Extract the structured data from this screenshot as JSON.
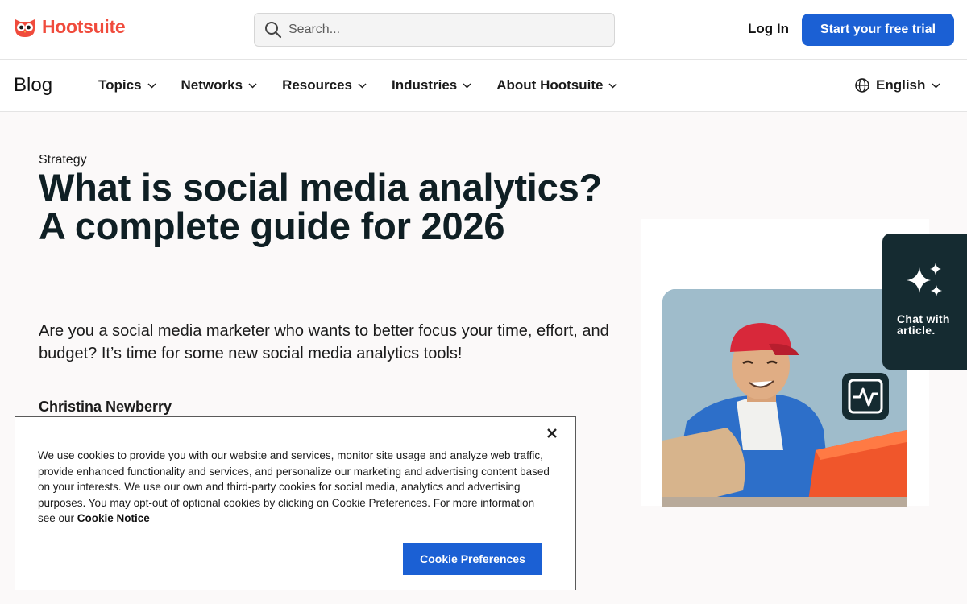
{
  "header": {
    "logo_text": "Hootsuite",
    "search_placeholder": "Search...",
    "login_label": "Log In",
    "trial_label": "Start your free trial",
    "brand_color": "#f04b3c",
    "accent_color": "#1b60d4"
  },
  "nav": {
    "blog_label": "Blog",
    "items": [
      {
        "label": "Topics"
      },
      {
        "label": "Networks"
      },
      {
        "label": "Resources"
      },
      {
        "label": "Industries"
      },
      {
        "label": "About Hootsuite"
      }
    ],
    "language": "English"
  },
  "article": {
    "category": "Strategy",
    "title": "What is social media analytics? A complete guide for 2026",
    "lede": "Are you a social media marketer who wants to better focus your time, effort, and budget? It’s time for some new social media analytics tools!",
    "author": "Christina Newberry"
  },
  "chat": {
    "label": "Chat with article."
  },
  "cookie": {
    "text": "We use cookies to provide you with our website and services, monitor site usage and analyze web traffic, provide enhanced functionality and services, and personalize our marketing and advertising content based on your interests. We use our own and third-party cookies for social media, analytics and advertising purposes. You may opt-out of optional cookies by clicking on Cookie Preferences. For more information see our",
    "link_label": "Cookie Notice",
    "button_label": "Cookie Preferences"
  },
  "icons": {
    "logo": "owl-icon",
    "search": "search-icon",
    "language": "globe-icon",
    "chat": "sparkle-icon",
    "analytics": "pulse-chart-icon",
    "close": "close-icon"
  }
}
